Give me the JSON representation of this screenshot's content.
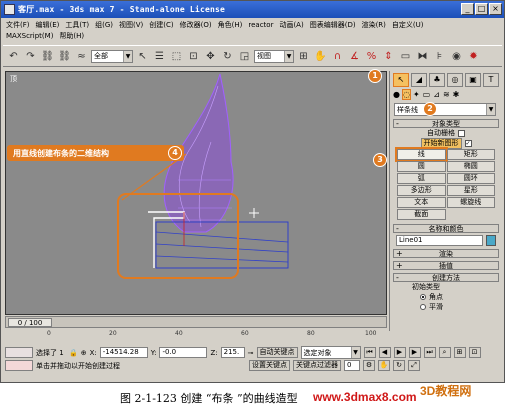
{
  "window": {
    "title": "客厅.max - 3ds max 7 - Stand-alone License",
    "controls": [
      "_",
      "□",
      "×"
    ]
  },
  "menus": {
    "row1": [
      "文件(F)",
      "编辑(E)",
      "工具(T)",
      "组(G)",
      "视图(V)",
      "创建(C)",
      "修改器(O)",
      "角色(H)",
      "reactor",
      "动画(A)",
      "图表编辑器(D)",
      "渲染(R)",
      "自定义(U)"
    ],
    "row2": [
      "MAXScript(M)",
      "帮助(H)"
    ]
  },
  "toolbar": {
    "selection_filter": "全部",
    "coord_system": "视图"
  },
  "viewport": {
    "label": "顶",
    "callout_text": "用直线创建布条的二维结构",
    "callout_badge": "4"
  },
  "badges": {
    "b1": "1",
    "b2": "2",
    "b3": "3"
  },
  "command_panel": {
    "category_dropdown": "样条线",
    "object_type_header": "对象类型",
    "autogrid_label": "自动栅格",
    "start_new_shape": "开始新图形",
    "buttons": [
      "线",
      "矩形",
      "圆",
      "椭圆",
      "弧",
      "圆环",
      "多边形",
      "星形",
      "文本",
      "螺旋线",
      "截面"
    ],
    "name_color_header": "名称和颜色",
    "object_name": "Line01",
    "render_header": "渲染",
    "interp_header": "插值",
    "creation_method_header": "创建方法",
    "initial_type_label": "初始类型",
    "radio_corner": "角点",
    "radio_smooth": "平滑"
  },
  "timeline": {
    "frame": "0 / 100",
    "ticks": [
      "0",
      "20",
      "40",
      "60",
      "80",
      "100"
    ]
  },
  "statusbar": {
    "selection_status": "选择了 1",
    "x_label": "X:",
    "x_value": "-14514.28",
    "y_label": "Y:",
    "y_value": "-0.0",
    "z_label": "Z:",
    "z_value": "215.",
    "auto_key": "自动关键点",
    "set_key": "设置关键点",
    "selected_dropdown": "选定对象",
    "key_filters": "关键点过滤器",
    "prompt": "单击并拖动以开始创建过程",
    "frame_value": "0"
  },
  "caption": {
    "figure_text": "图 2-1-123   创建 “布条 ”的曲线造型",
    "site": "www.3dmax8.com",
    "logo": "3D教程网"
  }
}
